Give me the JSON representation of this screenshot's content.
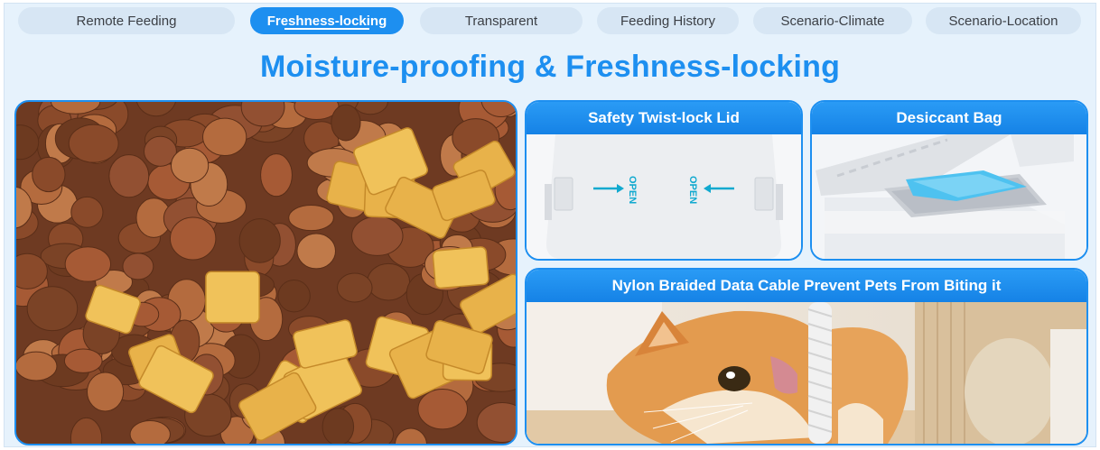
{
  "tabs": [
    {
      "label": "Remote Feeding"
    },
    {
      "label": "Freshness-locking",
      "active": true
    },
    {
      "label": "Transparent"
    },
    {
      "label": "Feeding History"
    },
    {
      "label": "Scenario-Climate"
    },
    {
      "label": "Scenario-Location"
    }
  ],
  "headline": "Moisture-proofing & Freshness-locking",
  "panels": {
    "food": {
      "image": "kibble-photo"
    },
    "lid": {
      "title": "Safety Twist-lock Lid",
      "open_left": "OPEN",
      "open_right": "OPEN"
    },
    "desiccant": {
      "title": "Desiccant Bag"
    },
    "cable": {
      "title": "Nylon Braided Data Cable Prevent Pets From Biting it"
    }
  },
  "colors": {
    "accent": "#1d8ff0",
    "background": "#e6f2fc",
    "tab_inactive": "#d7e6f4",
    "open_text": "#11a9cf"
  }
}
